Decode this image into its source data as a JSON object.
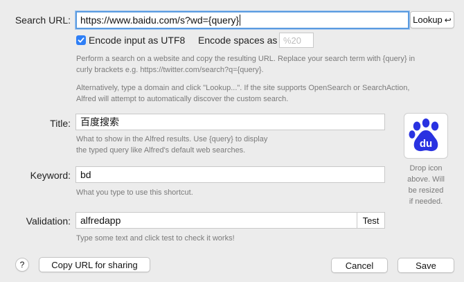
{
  "search_url": {
    "label": "Search URL:",
    "value": "https://www.baidu.com/s?wd={query}",
    "lookup_label": "Lookup",
    "lookup_icon": "return-arrow-icon"
  },
  "options": {
    "encode_utf8_label": "Encode input as UTF8",
    "encode_utf8_checked": true,
    "encode_spaces_label": "Encode spaces as",
    "encode_spaces_placeholder": "%20"
  },
  "help": {
    "url_help_1": "Perform a search on a website and copy the resulting URL. Replace your search term with {query} in",
    "url_help_2": "curly brackets e.g. https://twitter.com/search?q={query}.",
    "lookup_help_1": "Alternatively, type a domain and click \"Lookup...\". If the site supports OpenSearch or SearchAction,",
    "lookup_help_2": "Alfred will attempt to automatically discover the custom search."
  },
  "title": {
    "label": "Title:",
    "value": "百度搜索",
    "help_1": "What to show in the Alfred results. Use {query} to display",
    "help_2": "the typed query like Alfred's default web searches."
  },
  "keyword": {
    "label": "Keyword:",
    "value": "bd",
    "help": "What you type to use this shortcut."
  },
  "validation": {
    "label": "Validation:",
    "value": "alfredapp",
    "test_label": "Test",
    "help": "Type some text and click test to check it works!"
  },
  "icon": {
    "name": "baidu-paw-icon",
    "brand_color": "#2932e1",
    "text": "du",
    "help_1": "Drop icon",
    "help_2": "above. Will",
    "help_3": "be resized",
    "help_4": "if needed."
  },
  "footer": {
    "help_label": "?",
    "copy_label": "Copy URL for sharing",
    "cancel_label": "Cancel",
    "save_label": "Save"
  }
}
